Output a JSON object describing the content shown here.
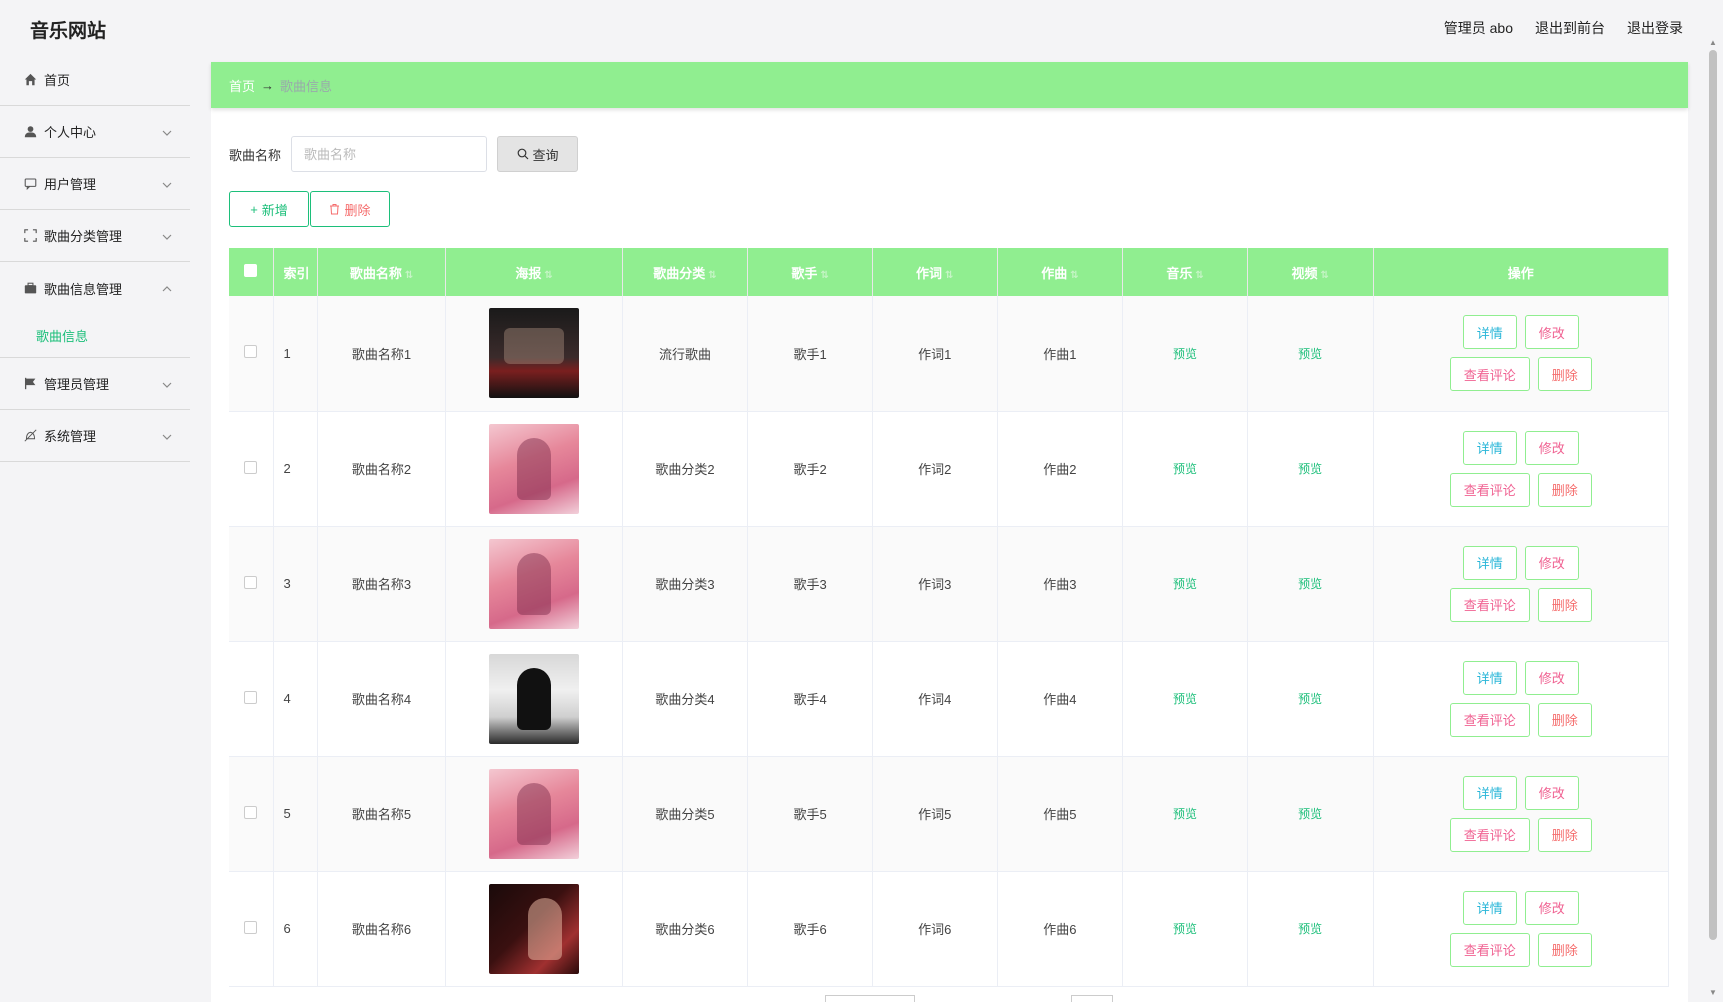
{
  "header": {
    "logo": "音乐网站",
    "admin": "管理员 abo",
    "to_front": "退出到前台",
    "logout": "退出登录"
  },
  "sidebar": {
    "items": [
      {
        "label": "首页",
        "icon": "home-icon"
      },
      {
        "label": "个人中心",
        "icon": "user-icon"
      },
      {
        "label": "用户管理",
        "icon": "chat-icon"
      },
      {
        "label": "歌曲分类管理",
        "icon": "fullscreen-icon"
      },
      {
        "label": "歌曲信息管理",
        "icon": "briefcase-icon"
      },
      {
        "label": "管理员管理",
        "icon": "flag-icon"
      },
      {
        "label": "系统管理",
        "icon": "mute-icon"
      }
    ],
    "sub_item": "歌曲信息"
  },
  "breadcrumb": {
    "home": "首页",
    "sep": "→",
    "current": "歌曲信息"
  },
  "search": {
    "label": "歌曲名称",
    "placeholder": "歌曲名称",
    "button": "查询"
  },
  "actions": {
    "add": "新增",
    "delete": "删除"
  },
  "table": {
    "headers": {
      "index": "索引",
      "name": "歌曲名称",
      "poster": "海报",
      "category": "歌曲分类",
      "singer": "歌手",
      "lyric": "作词",
      "compose": "作曲",
      "music": "音乐",
      "video": "视频",
      "ops": "操作"
    },
    "preview_label": "预览",
    "op_labels": {
      "detail": "详情",
      "edit": "修改",
      "comment": "查看评论",
      "delete": "删除"
    },
    "rows": [
      {
        "index": "1",
        "name": "歌曲名称1",
        "category": "流行歌曲",
        "singer": "歌手1",
        "lyric": "作词1",
        "compose": "作曲1",
        "poster": "stage"
      },
      {
        "index": "2",
        "name": "歌曲名称2",
        "category": "歌曲分类2",
        "singer": "歌手2",
        "lyric": "作词2",
        "compose": "作曲2",
        "poster": "pink"
      },
      {
        "index": "3",
        "name": "歌曲名称3",
        "category": "歌曲分类3",
        "singer": "歌手3",
        "lyric": "作词3",
        "compose": "作曲3",
        "poster": "pink"
      },
      {
        "index": "4",
        "name": "歌曲名称4",
        "category": "歌曲分类4",
        "singer": "歌手4",
        "lyric": "作词4",
        "compose": "作曲4",
        "poster": "gray"
      },
      {
        "index": "5",
        "name": "歌曲名称5",
        "category": "歌曲分类5",
        "singer": "歌手5",
        "lyric": "作词5",
        "compose": "作曲5",
        "poster": "pink"
      },
      {
        "index": "6",
        "name": "歌曲名称6",
        "category": "歌曲分类6",
        "singer": "歌手6",
        "lyric": "作词6",
        "compose": "作曲6",
        "poster": "dark"
      }
    ]
  },
  "colors": {
    "accent_green": "#90ee90",
    "link_green": "#1cbf7a",
    "pink": "#f06292",
    "cyan": "#29b6d8",
    "red": "#f56c6c"
  }
}
